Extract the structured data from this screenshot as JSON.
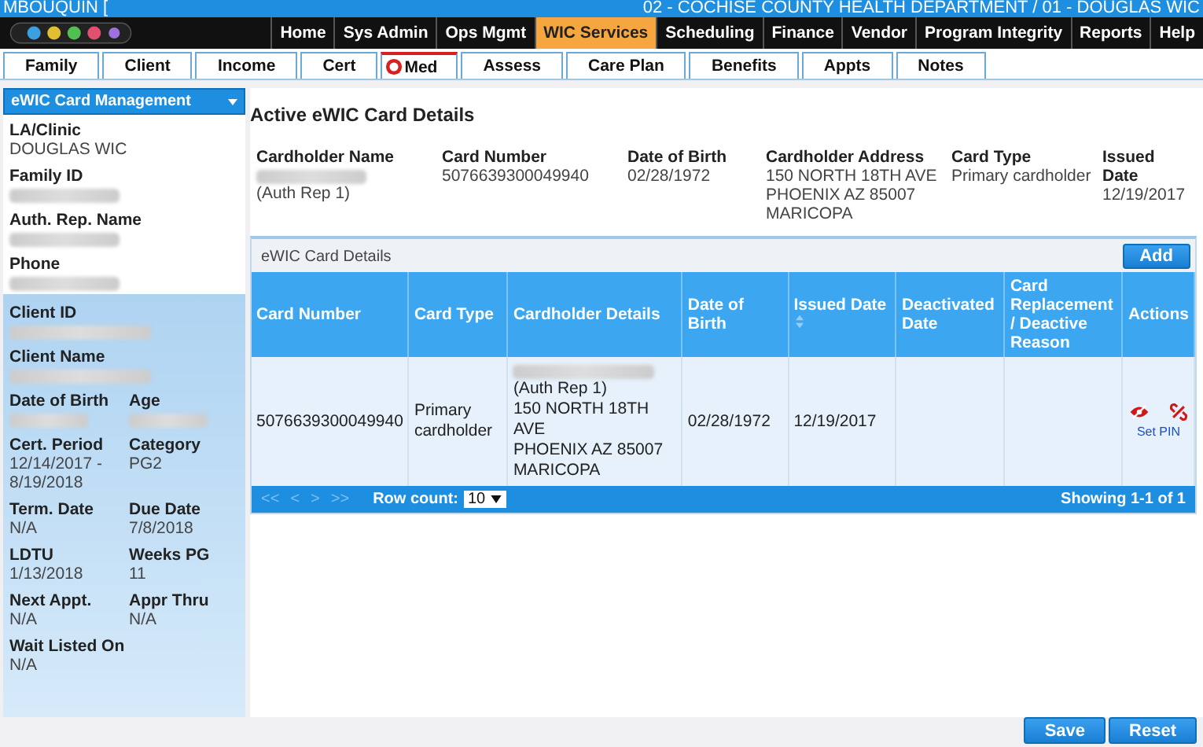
{
  "header": {
    "user": "MBOUQUIN [",
    "agency": "02 - COCHISE COUNTY HEALTH DEPARTMENT / 01 - DOUGLAS WIC"
  },
  "menu": [
    {
      "label": "Home",
      "selected": false
    },
    {
      "label": "Sys Admin",
      "selected": false
    },
    {
      "label": "Ops Mgmt",
      "selected": false
    },
    {
      "label": "WIC Services",
      "selected": true
    },
    {
      "label": "Scheduling",
      "selected": false
    },
    {
      "label": "Finance",
      "selected": false
    },
    {
      "label": "Vendor",
      "selected": false
    },
    {
      "label": "Program Integrity",
      "selected": false
    },
    {
      "label": "Reports",
      "selected": false
    },
    {
      "label": "Help",
      "selected": false
    }
  ],
  "tabs": [
    {
      "label": "Family",
      "alert": false
    },
    {
      "label": "Client",
      "alert": false
    },
    {
      "label": "Income",
      "alert": false
    },
    {
      "label": "Cert",
      "alert": false
    },
    {
      "label": "Med",
      "alert": true
    },
    {
      "label": "Assess",
      "alert": false
    },
    {
      "label": "Care Plan",
      "alert": false
    },
    {
      "label": "Benefits",
      "alert": false
    },
    {
      "label": "Appts",
      "alert": false
    },
    {
      "label": "Notes",
      "alert": false
    }
  ],
  "sidebar": {
    "dropdown": "eWIC Card Management",
    "family_fields": [
      {
        "label": "LA/Clinic",
        "value": "DOUGLAS WIC",
        "redacted": false
      },
      {
        "label": "Family ID",
        "redacted": true
      },
      {
        "label": "Auth. Rep. Name",
        "redacted": true
      },
      {
        "label": "Phone",
        "redacted": true
      }
    ],
    "client_fields": [
      {
        "label": "Client ID",
        "redacted": true
      },
      {
        "label": "Client Name",
        "redacted": true
      }
    ],
    "client_grid": [
      {
        "label": "Date of Birth",
        "redacted": true
      },
      {
        "label": "Age",
        "redacted": true
      },
      {
        "label": "Cert. Period",
        "value": "12/14/2017 - 8/19/2018",
        "redacted": false
      },
      {
        "label": "Category",
        "value": "PG2",
        "redacted": false
      },
      {
        "label": "Term. Date",
        "value": "N/A",
        "redacted": false
      },
      {
        "label": "Due Date",
        "value": "7/8/2018",
        "redacted": false
      },
      {
        "label": "LDTU",
        "value": "1/13/2018",
        "redacted": false
      },
      {
        "label": "Weeks PG",
        "value": "11",
        "redacted": false
      },
      {
        "label": "Next Appt.",
        "value": "N/A",
        "redacted": false
      },
      {
        "label": "Appr Thru",
        "value": "N/A",
        "redacted": false
      },
      {
        "label": "Wait Listed On",
        "value": "N/A",
        "redacted": false
      }
    ]
  },
  "active_card": {
    "title": "Active eWIC Card Details",
    "fields": [
      {
        "label": "Cardholder Name",
        "redacted": true,
        "lines": [
          "(Auth Rep 1)"
        ]
      },
      {
        "label": "Card Number",
        "redacted": false,
        "lines": [
          "5076639300049940"
        ]
      },
      {
        "label": "Date of Birth",
        "redacted": false,
        "lines": [
          "02/28/1972"
        ]
      },
      {
        "label": "Cardholder Address",
        "redacted": false,
        "lines": [
          "150 NORTH 18TH AVE",
          "PHOENIX AZ 85007",
          "MARICOPA"
        ]
      },
      {
        "label": "Card Type",
        "redacted": false,
        "lines": [
          "Primary cardholder"
        ]
      },
      {
        "label": "Issued Date",
        "redacted": false,
        "lines": [
          "12/19/2017"
        ]
      }
    ]
  },
  "card_table": {
    "title": "eWIC Card Details",
    "add_button": "Add",
    "columns": [
      {
        "label": "Card Number",
        "sortable": false
      },
      {
        "label": "Card Type",
        "sortable": false
      },
      {
        "label": "Cardholder Details",
        "sortable": false
      },
      {
        "label": "Date of Birth",
        "sortable": false
      },
      {
        "label": "Issued Date",
        "sortable": true
      },
      {
        "label": "Deactivated Date",
        "sortable": false
      },
      {
        "label": "Card Replacement / Deactive Reason",
        "sortable": false
      },
      {
        "label": "Actions",
        "sortable": false
      }
    ],
    "rows": [
      {
        "card_number": "5076639300049940",
        "card_type": "Primary cardholder",
        "cardholder_redacted": true,
        "cardholder_lines": [
          "(Auth Rep 1)",
          "150 NORTH 18TH AVE",
          "PHOENIX AZ 85007",
          "MARICOPA"
        ],
        "date_of_birth": "02/28/1972",
        "issued_date": "12/19/2017",
        "set_pin": "Set PIN"
      }
    ],
    "pager": {
      "buttons": [
        "<<",
        "<",
        ">",
        ">>"
      ],
      "row_count_label": "Row count:",
      "row_count": "10",
      "showing": "Showing 1-1 of 1"
    }
  },
  "buttons": [
    "Save",
    "Reset"
  ]
}
